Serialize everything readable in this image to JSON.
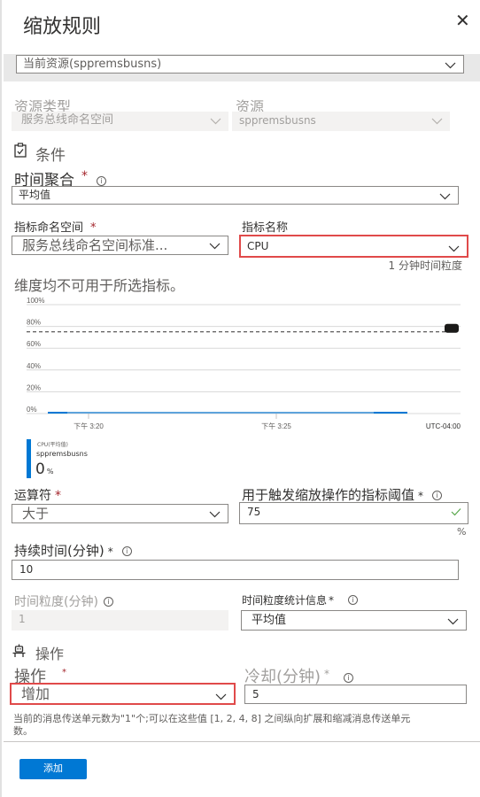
{
  "header": {
    "title": "缩放规则",
    "close_icon": "close-icon"
  },
  "scope": {
    "selected": "当前资源(sppremsbusns)"
  },
  "resource": {
    "type_label": "资源类型",
    "type_value": "服务总线命名空间",
    "resource_label": "资源",
    "resource_value": "sppremsbusns"
  },
  "condition": {
    "section_title": "条件",
    "section_icon": "clipboard-check-icon",
    "time_aggregation": {
      "label": "时间聚合",
      "required": "*",
      "value": "平均值"
    },
    "metric_namespace": {
      "label": "指标命名空间",
      "required": "*",
      "value": "服务总线命名空间标准..."
    },
    "metric_name": {
      "label": "指标名称",
      "value": "CPU"
    },
    "granularity_note": "1 分钟时间粒度",
    "dimension_note": "维度均不可用于所选指标。"
  },
  "chart_data": {
    "type": "line",
    "y_ticks": [
      "100%",
      "80%",
      "60%",
      "40%",
      "20%",
      "0%"
    ],
    "ylim": [
      0,
      100
    ],
    "x_ticks": [
      "下午 3:20",
      "下午 3:25"
    ],
    "timezone": "UTC-04:00",
    "threshold": 75,
    "series": [
      {
        "name": "CPU(平均值)",
        "resource": "sppremsbusns",
        "values": [
          0,
          0,
          0,
          0,
          0,
          0,
          0,
          0,
          0,
          0
        ],
        "color": "#0078d4"
      }
    ],
    "legend": {
      "metric": "CPU(平均值)",
      "resource": "sppremsbusns",
      "value": "0",
      "unit": "%"
    },
    "grid": true
  },
  "operator": {
    "label": "运算符",
    "required": "*",
    "value": "大于"
  },
  "threshold": {
    "label": "用于触发缩放操作的指标阈值",
    "required": "*",
    "value": "75",
    "unit": "%"
  },
  "duration": {
    "label": "持续时间(分钟)",
    "required": "*",
    "value": "10"
  },
  "time_grain": {
    "label": "时间粒度(分钟)",
    "value": "1"
  },
  "time_grain_stat": {
    "label": "时间粒度统计信息",
    "required": "*",
    "value": "平均值"
  },
  "action": {
    "section_title": "操作",
    "section_icon": "robot-icon",
    "operation": {
      "label": "操作",
      "required": "*",
      "value": "增加"
    },
    "cooldown": {
      "label": "冷却(分钟)",
      "required": "*",
      "value": "5"
    },
    "note": "当前的消息传送单元数为\"1\"个;可以在这些值 [1, 2, 4, 8] 之间纵向扩展和缩减消息传送单元数。"
  },
  "footer": {
    "add_label": "添加"
  },
  "colors": {
    "accent": "#0078d4",
    "highlight": "#e04a4a",
    "required": "#a4262c",
    "valid": "#57a64a"
  }
}
